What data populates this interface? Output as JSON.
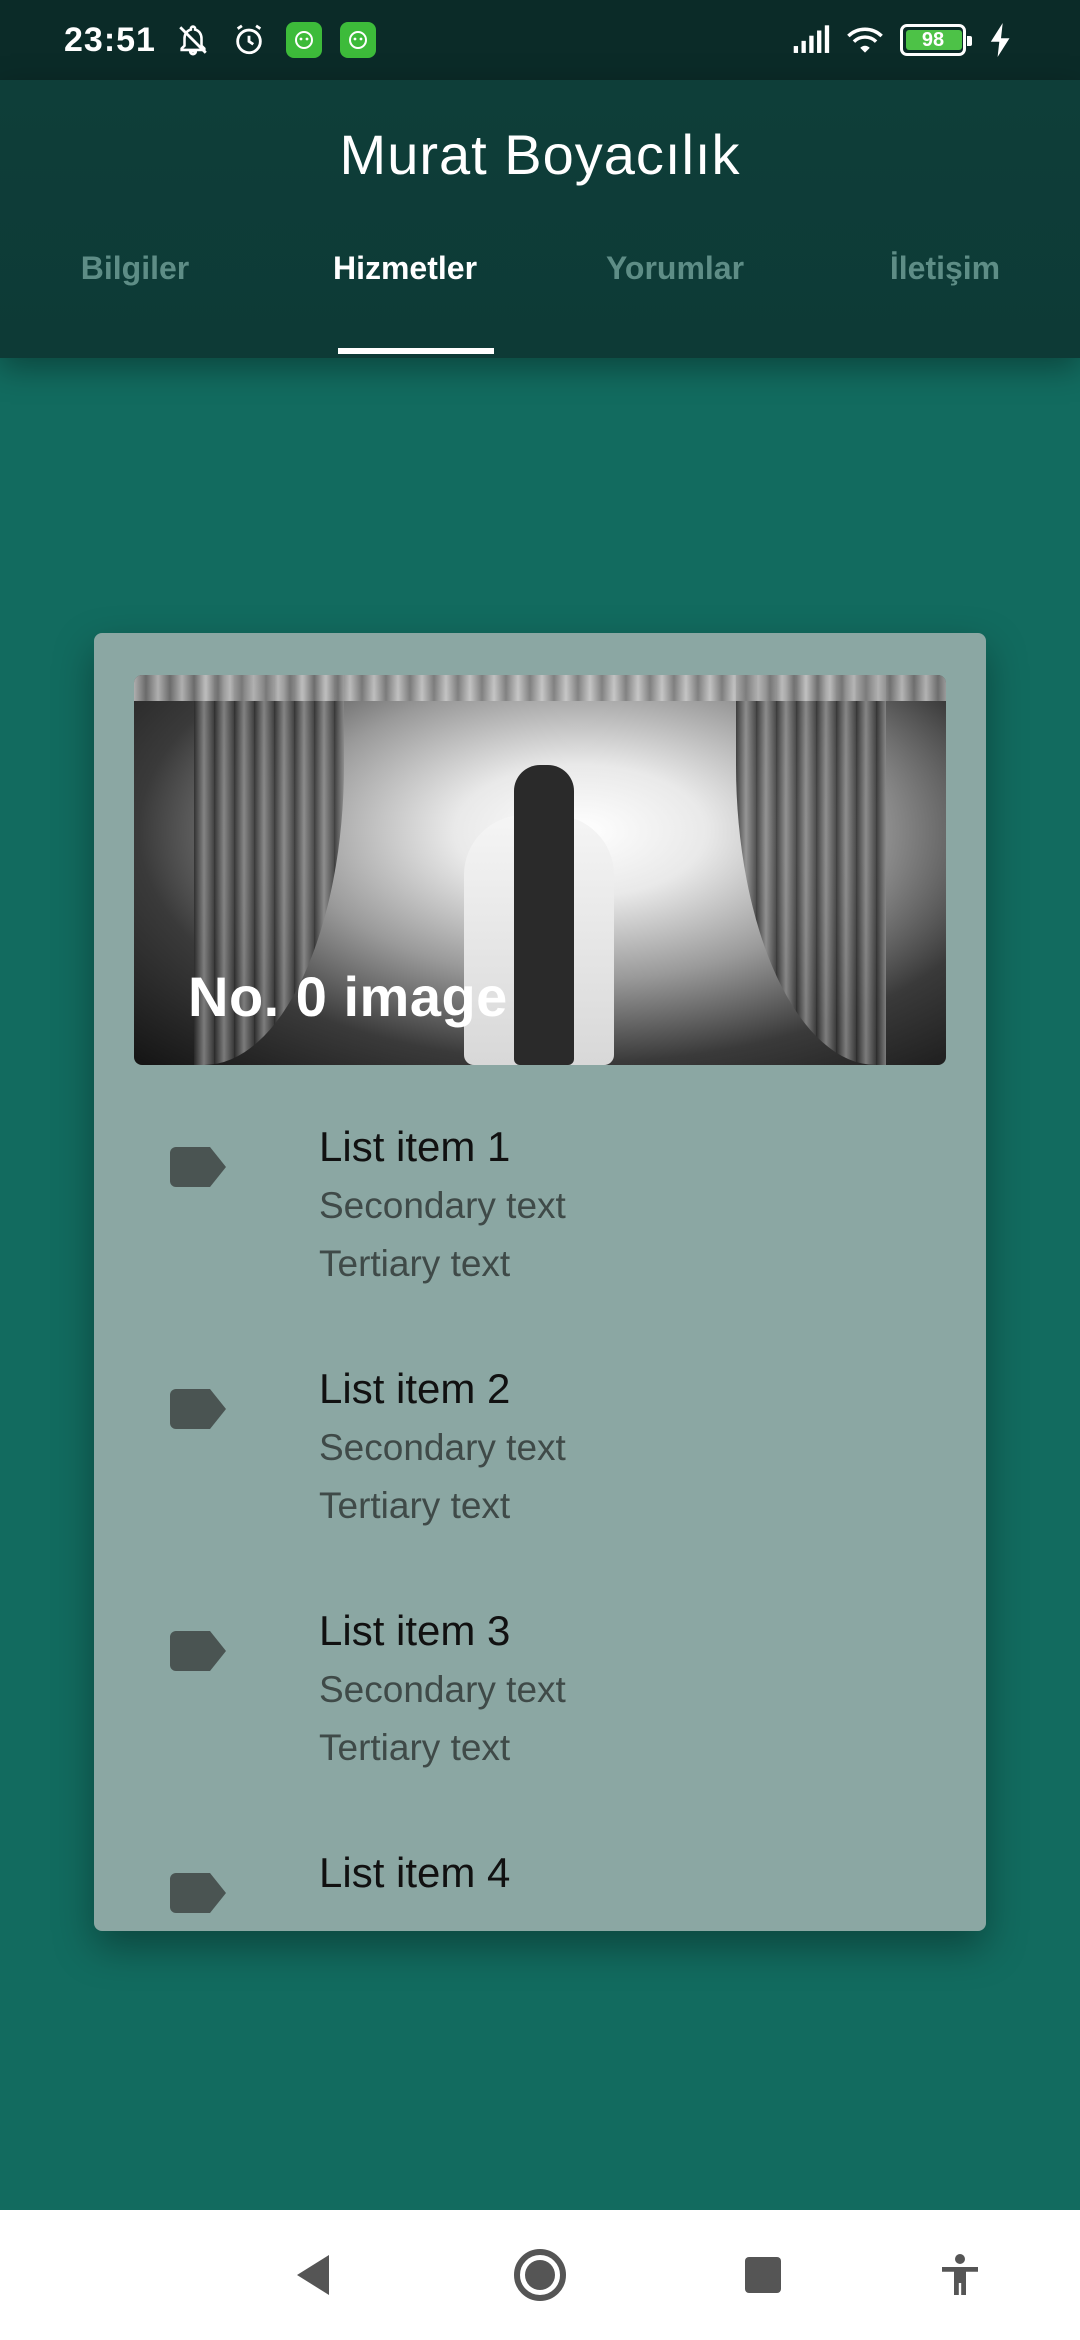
{
  "status_bar": {
    "time": "23:51",
    "battery_level": "98",
    "battery_fraction": 0.98,
    "icons": [
      "notifications-off-icon",
      "alarm-icon",
      "app-icon",
      "app-icon",
      "signal-icon",
      "wifi-icon",
      "battery-icon",
      "charging-icon"
    ]
  },
  "header": {
    "title": "Murat Boyacılık"
  },
  "tabs": [
    {
      "label": "Bilgiler",
      "active": false
    },
    {
      "label": "Hizmetler",
      "active": true
    },
    {
      "label": "Yorumlar",
      "active": false
    },
    {
      "label": "İletişim",
      "active": false
    }
  ],
  "card": {
    "image_caption": "No. 0 image",
    "items": [
      {
        "primary": "List item 1",
        "secondary": "Secondary text",
        "tertiary": "Tertiary text",
        "icon": "label-icon"
      },
      {
        "primary": "List item 2",
        "secondary": "Secondary text",
        "tertiary": "Tertiary text",
        "icon": "label-icon"
      },
      {
        "primary": "List item 3",
        "secondary": "Secondary text",
        "tertiary": "Tertiary text",
        "icon": "label-icon"
      },
      {
        "primary": "List item 4",
        "icon": "label-icon"
      }
    ]
  },
  "nav_bar": {
    "buttons": [
      "back-icon",
      "home-icon",
      "recents-icon",
      "accessibility-icon"
    ]
  },
  "colors": {
    "background": "#126B5F",
    "app_bar": "#0E3E39",
    "card": "#8BA7A3",
    "tab_inactive": "#5E8D86",
    "accent_badge": "#3DBB3A"
  }
}
